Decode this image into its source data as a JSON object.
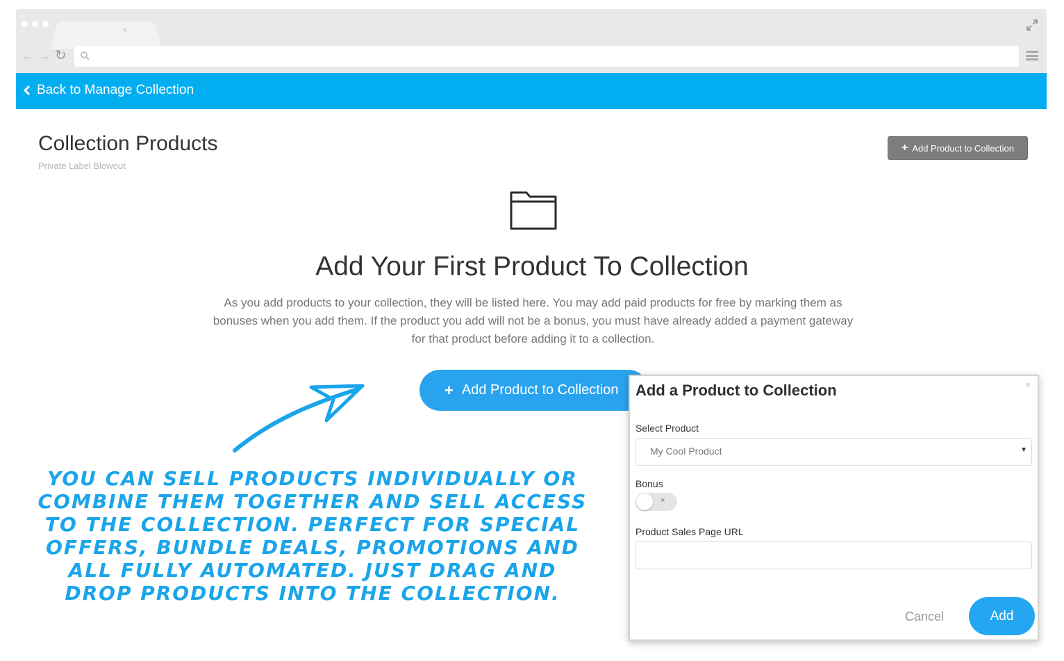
{
  "browser": {
    "tab_close": "×",
    "nav": {
      "back": "←",
      "forward": "→",
      "reload": "↻"
    }
  },
  "backbar": {
    "label": "Back to Manage Collection",
    "color": "#03aef0"
  },
  "header": {
    "title": "Collection Products",
    "subtitle": "Private Label Blowout",
    "add_button": {
      "plus": "+",
      "label": "Add Product to Collection"
    }
  },
  "empty_state": {
    "icon": "folder-icon",
    "title": "Add Your First Product To Collection",
    "description": "As you add products to your collection, they will be listed here. You may add paid products for free by marking them as bonuses when you add them. If the product you add will not be a bonus, you must have already added a payment gateway for that product before adding it to a collection.",
    "add_button": {
      "plus": "+",
      "label": "Add Product to Collection"
    }
  },
  "annotation": {
    "text": "You can sell products individually or combine them together and sell access to the collection.  Perfect for special offers, bundle deals, promotions and all fully automated.  Just drag and drop products into the collection.",
    "color": "#1aa5ea"
  },
  "modal": {
    "title": "Add a Product to Collection",
    "close": "×",
    "select_product": {
      "label": "Select Product",
      "value": "My Cool Product",
      "caret": "▼"
    },
    "bonus": {
      "label": "Bonus",
      "toggle_off_mark": "×",
      "on": false
    },
    "sales_url": {
      "label": "Product Sales Page URL",
      "value": ""
    },
    "cancel_label": "Cancel",
    "add_label": "Add"
  }
}
